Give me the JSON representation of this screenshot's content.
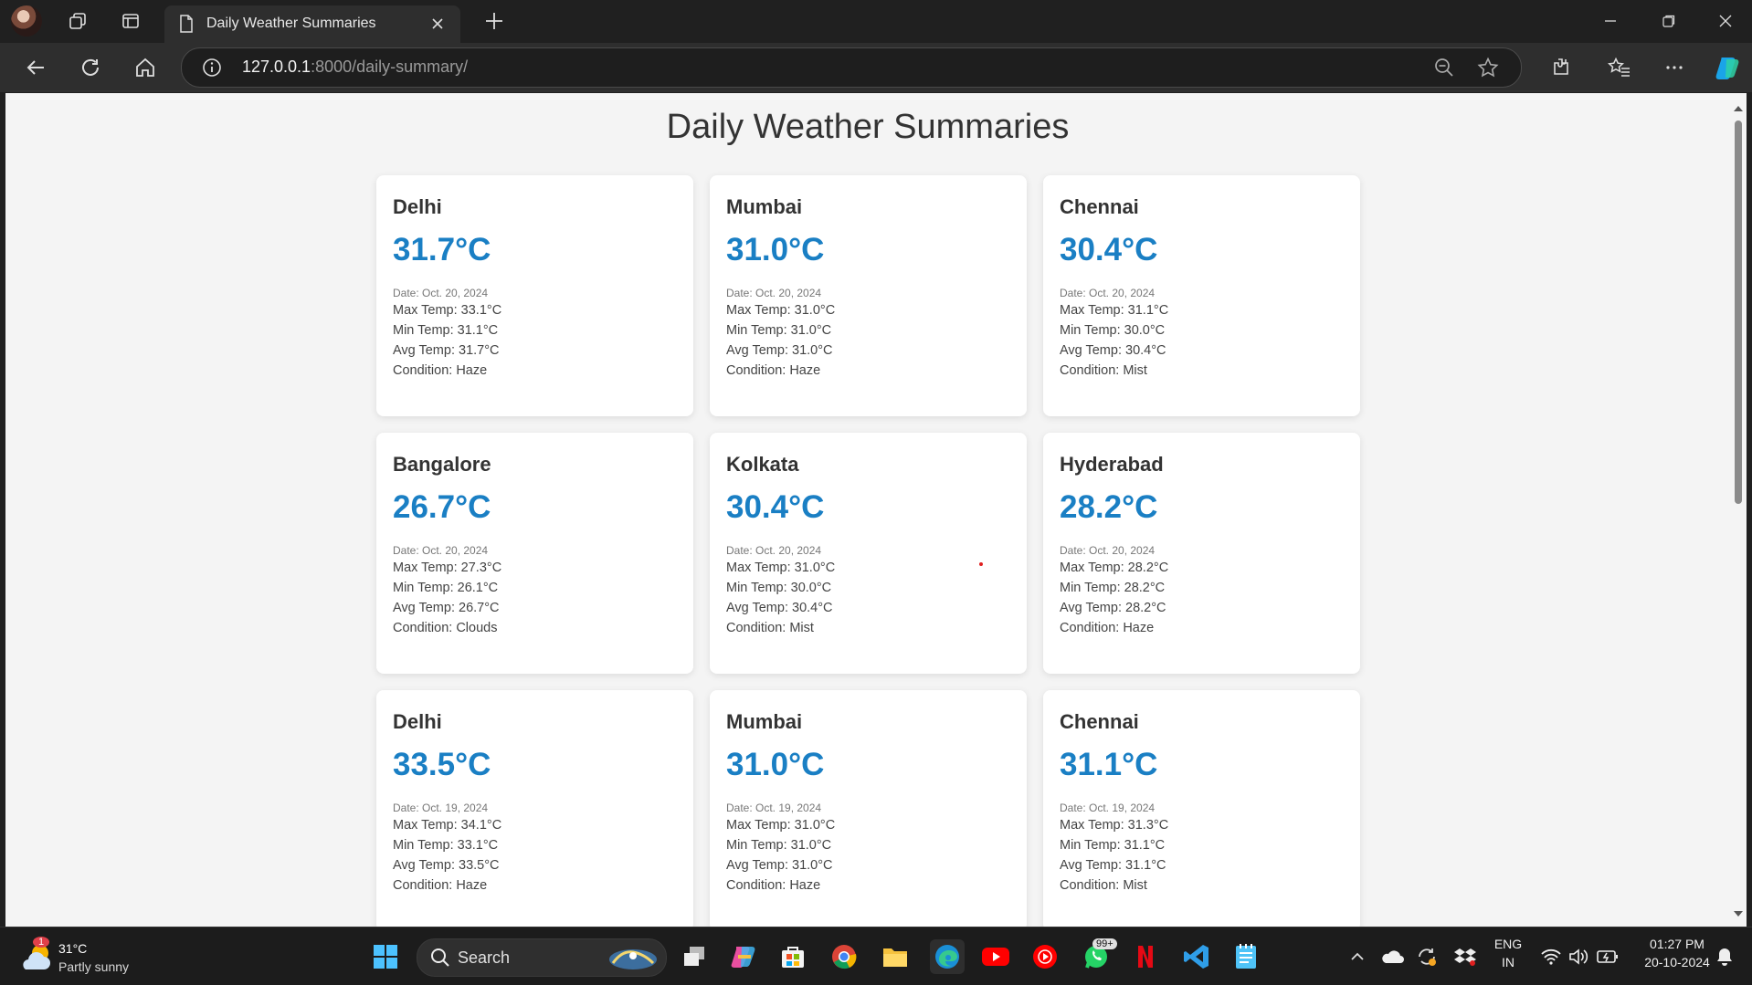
{
  "browser": {
    "tab_title": "Daily Weather Summaries",
    "url_host": "127.0.0.1",
    "url_rest": ":8000/daily-summary/"
  },
  "page": {
    "title": "Daily Weather Summaries",
    "cards": [
      {
        "city": "Delhi",
        "temp": "31.7°C",
        "date": "Date: Oct. 20, 2024",
        "max": "Max Temp: 33.1°C",
        "min": "Min Temp: 31.1°C",
        "avg": "Avg Temp: 31.7°C",
        "condition": "Condition: Haze"
      },
      {
        "city": "Mumbai",
        "temp": "31.0°C",
        "date": "Date: Oct. 20, 2024",
        "max": "Max Temp: 31.0°C",
        "min": "Min Temp: 31.0°C",
        "avg": "Avg Temp: 31.0°C",
        "condition": "Condition: Haze"
      },
      {
        "city": "Chennai",
        "temp": "30.4°C",
        "date": "Date: Oct. 20, 2024",
        "max": "Max Temp: 31.1°C",
        "min": "Min Temp: 30.0°C",
        "avg": "Avg Temp: 30.4°C",
        "condition": "Condition: Mist"
      },
      {
        "city": "Bangalore",
        "temp": "26.7°C",
        "date": "Date: Oct. 20, 2024",
        "max": "Max Temp: 27.3°C",
        "min": "Min Temp: 26.1°C",
        "avg": "Avg Temp: 26.7°C",
        "condition": "Condition: Clouds"
      },
      {
        "city": "Kolkata",
        "temp": "30.4°C",
        "date": "Date: Oct. 20, 2024",
        "max": "Max Temp: 31.0°C",
        "min": "Min Temp: 30.0°C",
        "avg": "Avg Temp: 30.4°C",
        "condition": "Condition: Mist"
      },
      {
        "city": "Hyderabad",
        "temp": "28.2°C",
        "date": "Date: Oct. 20, 2024",
        "max": "Max Temp: 28.2°C",
        "min": "Min Temp: 28.2°C",
        "avg": "Avg Temp: 28.2°C",
        "condition": "Condition: Haze"
      },
      {
        "city": "Delhi",
        "temp": "33.5°C",
        "date": "Date: Oct. 19, 2024",
        "max": "Max Temp: 34.1°C",
        "min": "Min Temp: 33.1°C",
        "avg": "Avg Temp: 33.5°C",
        "condition": "Condition: Haze"
      },
      {
        "city": "Mumbai",
        "temp": "31.0°C",
        "date": "Date: Oct. 19, 2024",
        "max": "Max Temp: 31.0°C",
        "min": "Min Temp: 31.0°C",
        "avg": "Avg Temp: 31.0°C",
        "condition": "Condition: Haze"
      },
      {
        "city": "Chennai",
        "temp": "31.1°C",
        "date": "Date: Oct. 19, 2024",
        "max": "Max Temp: 31.3°C",
        "min": "Min Temp: 31.1°C",
        "avg": "Avg Temp: 31.1°C",
        "condition": "Condition: Mist"
      }
    ]
  },
  "taskbar": {
    "weather_temp": "31°C",
    "weather_condition": "Partly sunny",
    "weather_badge": "1",
    "search_label": "Search",
    "whatsapp_badge": "99+",
    "lang_top": "ENG",
    "lang_bottom": "IN",
    "time": "01:27 PM",
    "date": "20-10-2024"
  },
  "colors": {
    "accent": "#1a7fc4",
    "page_bg": "#f4f4f4",
    "card_bg": "#ffffff",
    "browser_chrome": "#202020"
  },
  "icons": [
    "profile-avatar",
    "workspaces-icon",
    "tab-actions-icon",
    "page-icon",
    "close-icon",
    "new-tab-icon",
    "minimize-icon",
    "restore-icon",
    "close-window-icon",
    "back-icon",
    "refresh-icon",
    "home-icon",
    "site-info-icon",
    "zoom-out-icon",
    "favorite-star-icon",
    "extensions-icon",
    "favorites-icon",
    "more-icon",
    "copilot-icon",
    "windows-start-icon",
    "search-icon",
    "task-view-icon",
    "copilot-app-icon",
    "store-icon",
    "chrome-icon",
    "file-explorer-icon",
    "edge-icon",
    "youtube-icon",
    "youtube-music-icon",
    "whatsapp-icon",
    "netflix-icon",
    "vscode-icon",
    "notepad-icon",
    "chevron-up-icon",
    "onedrive-icon",
    "sync-icon",
    "dropbox-icon",
    "wifi-icon",
    "volume-icon",
    "battery-icon",
    "notification-bell-icon"
  ]
}
